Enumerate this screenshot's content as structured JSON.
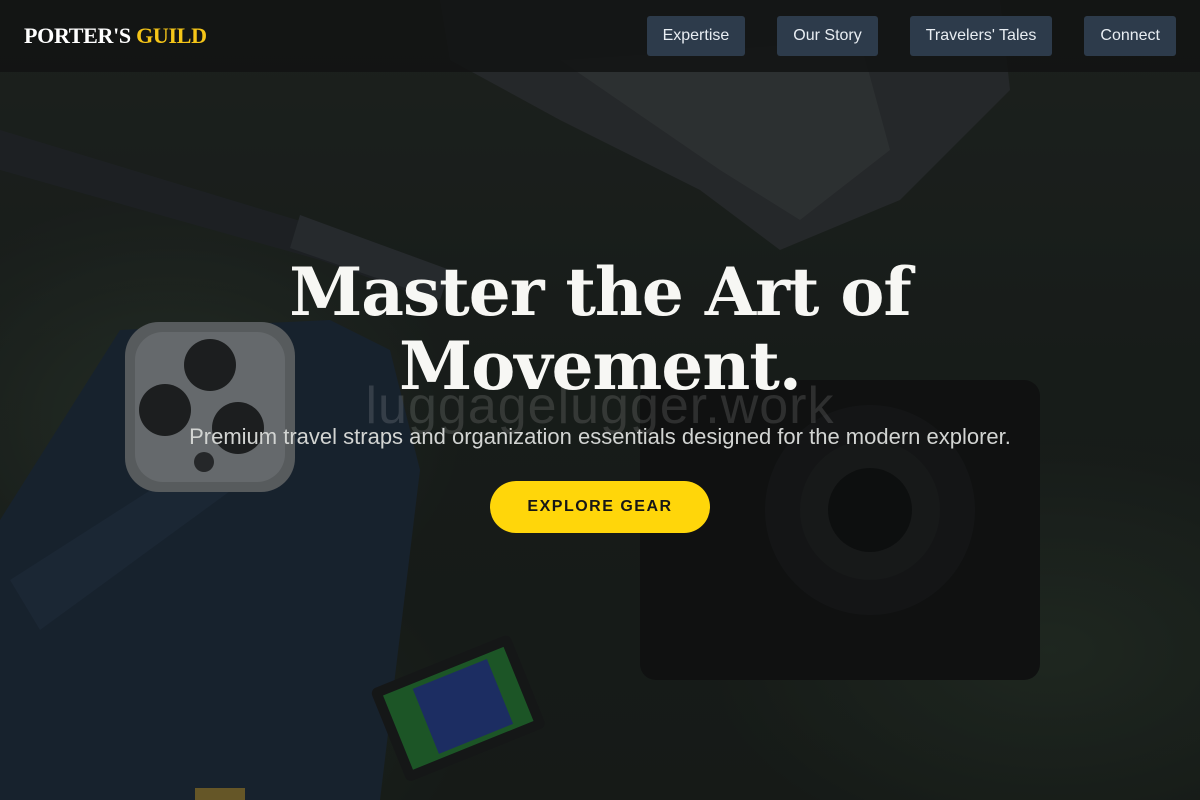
{
  "header": {
    "logo_main": "PORTER'S",
    "logo_accent": "GUILD",
    "nav": [
      {
        "label": "Expertise"
      },
      {
        "label": "Our Story"
      },
      {
        "label": "Travelers' Tales"
      },
      {
        "label": "Connect"
      }
    ]
  },
  "hero": {
    "title_line1": "Master the Art of",
    "title_line2": "Movement.",
    "subtitle": "Premium travel straps and organization essentials designed for the modern explorer.",
    "cta_label": "EXPLORE GEAR"
  },
  "watermark": "luggagelugger.work",
  "colors": {
    "accent": "#f5c518",
    "nav_button_bg": "#2d3b4b",
    "cta_bg": "#ffd60a"
  }
}
